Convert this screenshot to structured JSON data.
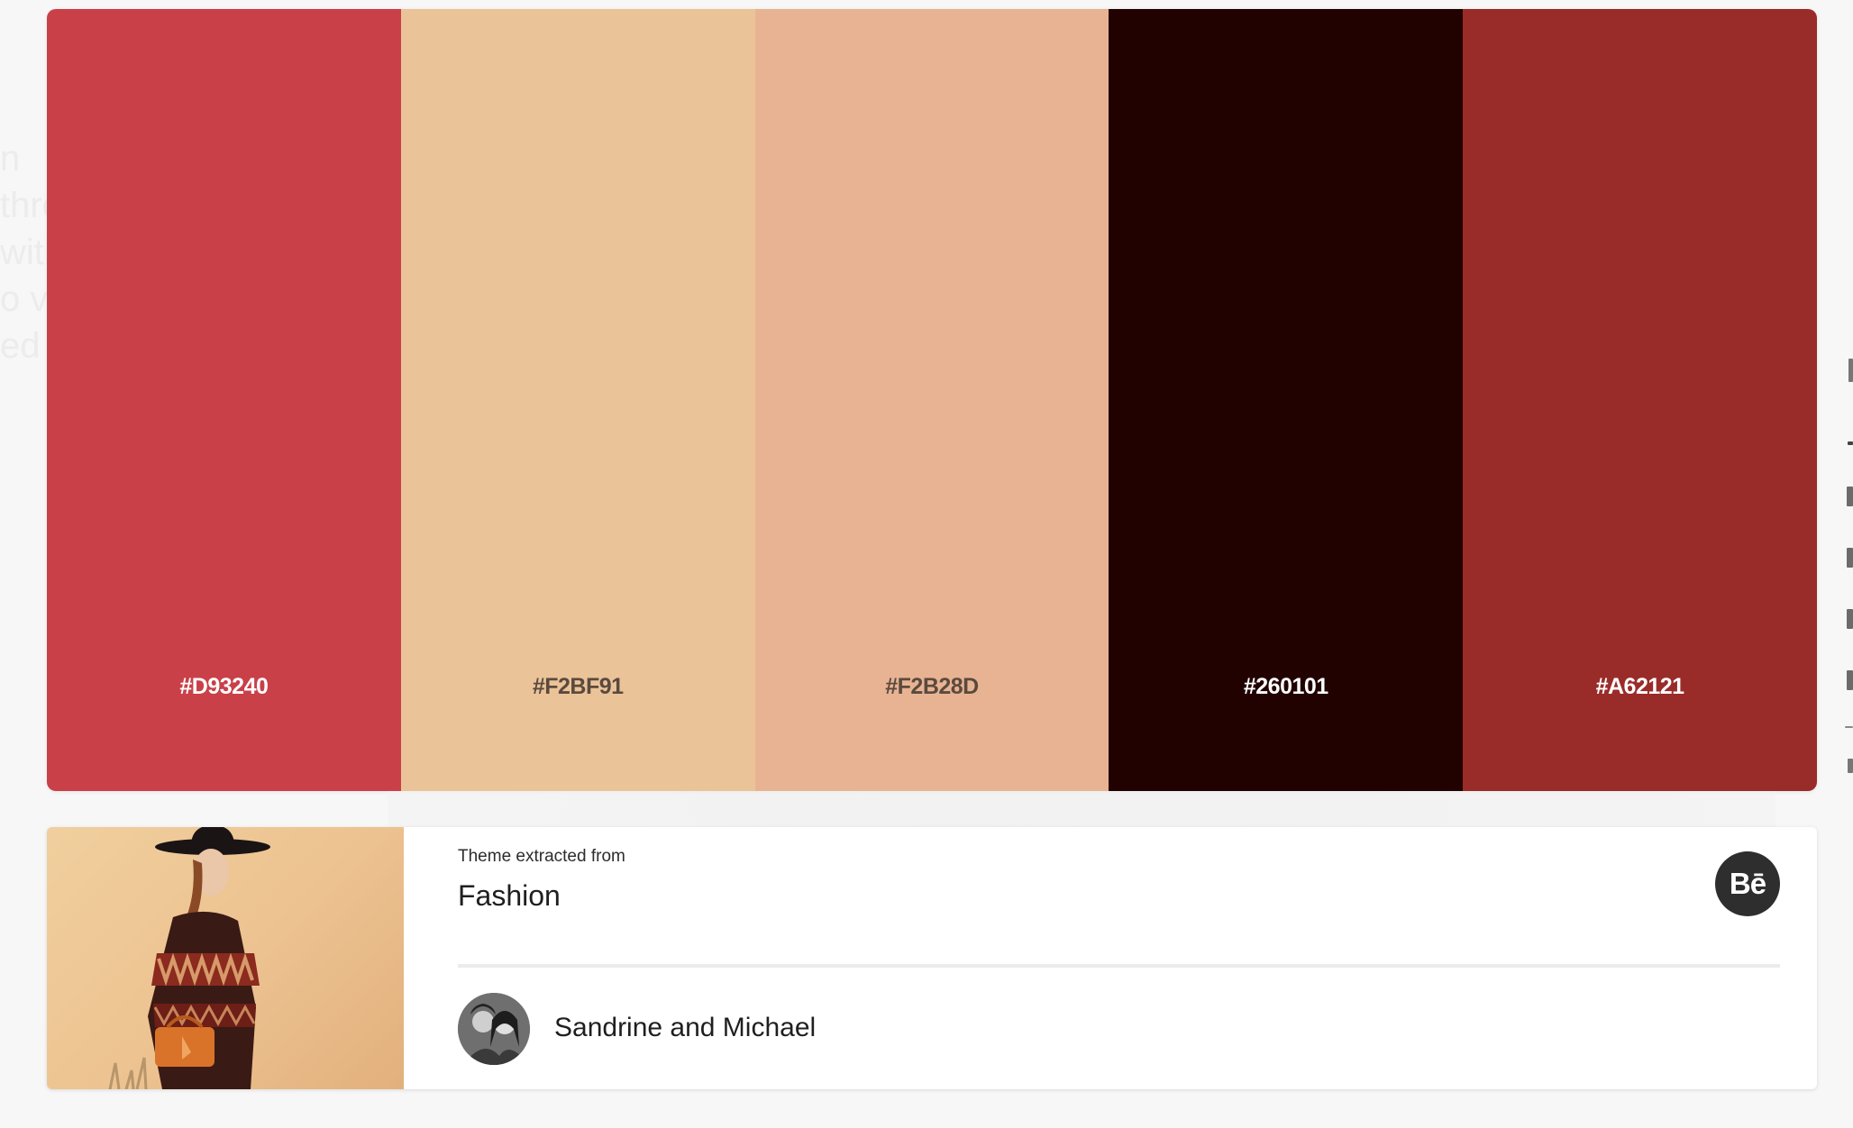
{
  "palette": {
    "swatches": [
      {
        "hex": "#D93240",
        "color": "#C94048",
        "text_color": "#ffffff"
      },
      {
        "hex": "#F2BF91",
        "color": "#EBC398",
        "text_color": "#5a4a3e"
      },
      {
        "hex": "#F2B28D",
        "color": "#E8B393",
        "text_color": "#5a4a3e"
      },
      {
        "hex": "#260101",
        "color": "#220201",
        "text_color": "#ffffff"
      },
      {
        "hex": "#A62121",
        "color": "#992C29",
        "text_color": "#ffffff"
      }
    ]
  },
  "card": {
    "source_label": "Theme extracted from",
    "source_title": "Fashion",
    "behance_label": "Bē",
    "author_name": "Sandrine and Michael"
  },
  "icons": {
    "behance": "behance-icon",
    "avatar": "author-avatar"
  }
}
